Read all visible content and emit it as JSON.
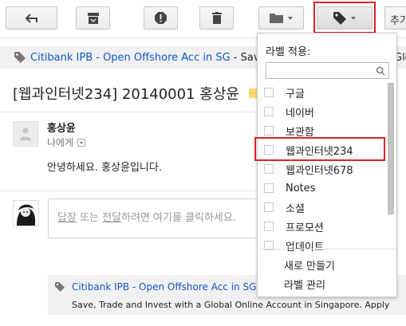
{
  "toolbar": {
    "more_label": "추가",
    "icons": [
      "back-arrow-icon",
      "archive-icon",
      "report-spam-icon",
      "trash-icon",
      "folder-icon",
      "label-icon"
    ]
  },
  "top_ad": {
    "link_text": "Citibank IPB - Open Offshore Acc in SG",
    "suffix": " - Sav",
    "right_hint": "Glo"
  },
  "message": {
    "subject": "[웹과인터넷234] 20140001 홍상윤",
    "sender_name": "홍상윤",
    "recipient": "나에게",
    "body": "안녕하세요. 홍상윤입니다."
  },
  "reply": {
    "reply_link": "답장",
    "middle": " 또는 ",
    "forward_link": "전달",
    "suffix": "하려면 여기를 클릭하세요."
  },
  "bottom_ad": {
    "link_text": "Citibank IPB - Open Offshore Acc in SG",
    "description": "Save, Trade and Invest with a Global Online Account in Singapore. Apply"
  },
  "label_menu": {
    "title": "라벨 적용:",
    "search_value": "",
    "items": [
      "구글",
      "네이버",
      "보관함",
      "웹과인터넷234",
      "웹과인터넷678",
      "Notes",
      "소셜",
      "프로모션",
      "업데이트"
    ],
    "create_new": "새로 만들기",
    "manage": "라벨 관리"
  },
  "colors": {
    "link": "#1155cc",
    "highlight": "#e0202a",
    "label_chip": "#ffd76e"
  }
}
